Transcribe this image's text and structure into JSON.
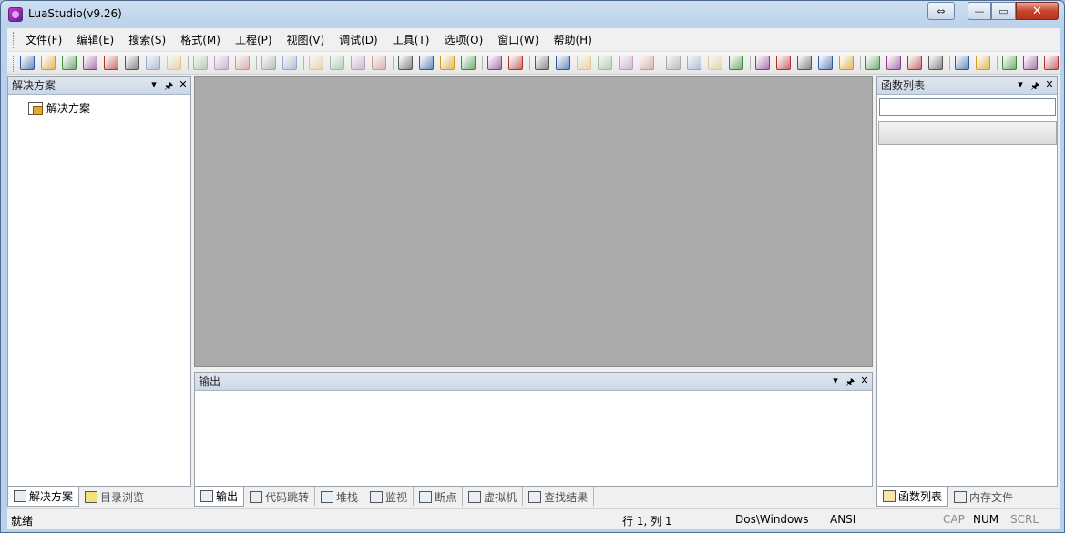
{
  "window": {
    "title": "LuaStudio(v9.26)",
    "minimize_glyph": "—",
    "maximize_glyph": "▭",
    "close_glyph": "✕",
    "restore_glyph": "⇔"
  },
  "menu": [
    "文件(F)",
    "编辑(E)",
    "搜索(S)",
    "格式(M)",
    "工程(P)",
    "视图(V)",
    "调试(D)",
    "工具(T)",
    "选项(O)",
    "窗口(W)",
    "帮助(H)"
  ],
  "toolbar": {
    "icons": [
      "new-file-icon",
      "new-project-icon",
      "open-icon",
      "open-project-icon",
      "save-project-icon",
      "tree-icon",
      "save-icon",
      "save-all-icon",
      "cut-icon",
      "copy-icon",
      "paste-icon",
      "undo-icon",
      "redo-icon",
      "comment-icon",
      "uncomment-icon",
      "indent-icon",
      "outdent-icon",
      "find-icon",
      "find-in-files-icon",
      "replace-icon",
      "replace-in-files-icon",
      "bookmark-icon",
      "bookmark-next-icon",
      "fullscreen-icon",
      "word-wrap-icon",
      "pilcrow-icon",
      "list-icon",
      "outline-icon",
      "check-icon",
      "run-icon",
      "step-into-icon",
      "step-over-icon",
      "step-out-icon",
      "hand-icon",
      "breakpoint-icon",
      "clear-breakpoints-icon",
      "watch-icon",
      "callstack-icon",
      "exclamation-icon",
      "brace1-icon",
      "brace2-icon",
      "brace3-icon",
      "screenshot-icon",
      "export-icon",
      "print-icon",
      "help-icon",
      "home-icon"
    ]
  },
  "left_panel": {
    "title": "解决方案",
    "tree_root": "解决方案",
    "tabs": [
      "解决方案",
      "目录浏览"
    ]
  },
  "output_panel": {
    "title": "输出",
    "tabs": [
      "输出",
      "代码跳转",
      "堆栈",
      "监视",
      "断点",
      "虚拟机",
      "查找结果"
    ]
  },
  "right_panel": {
    "title": "函数列表",
    "search_value": "",
    "tabs": [
      "函数列表",
      "内存文件"
    ]
  },
  "panel_controls": {
    "dropdown": "▾",
    "pin": "🖈",
    "close": "✕"
  },
  "status": {
    "left": "就绪",
    "position": "行 1, 列 1",
    "line_ending": "Dos\\Windows",
    "encoding": "ANSI",
    "cap": "CAP",
    "num": "NUM",
    "scrl": "SCRL"
  },
  "colors": {
    "editor_background": "#ababab",
    "panel_header": "#cdd8e6",
    "chrome": "#f0f0f0"
  }
}
